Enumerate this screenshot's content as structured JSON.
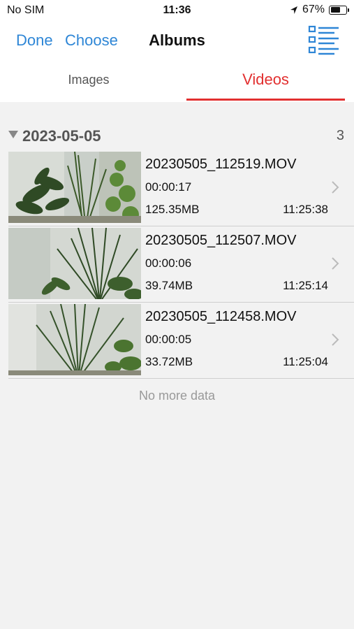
{
  "status": {
    "carrier": "No SIM",
    "time": "11:36",
    "battery_percent": "67%",
    "battery_level": 0.67,
    "location_icon": "location-arrow-icon"
  },
  "nav": {
    "done_label": "Done",
    "choose_label": "Choose",
    "title": "Albums",
    "list_icon": "list-view-icon",
    "accent_color": "#2e86d6"
  },
  "tabs": [
    {
      "label": "Images",
      "active": false
    },
    {
      "label": "Videos",
      "active": true
    }
  ],
  "active_color": "#e23030",
  "section": {
    "date": "2023-05-05",
    "count": "3"
  },
  "videos": [
    {
      "filename": "20230505_112519.MOV",
      "duration": "00:00:17",
      "size": "125.35MB",
      "time": "11:25:38"
    },
    {
      "filename": "20230505_112507.MOV",
      "duration": "00:00:06",
      "size": "39.74MB",
      "time": "11:25:14"
    },
    {
      "filename": "20230505_112458.MOV",
      "duration": "00:00:05",
      "size": "33.72MB",
      "time": "11:25:04"
    }
  ],
  "footer": {
    "no_more": "No more data"
  }
}
